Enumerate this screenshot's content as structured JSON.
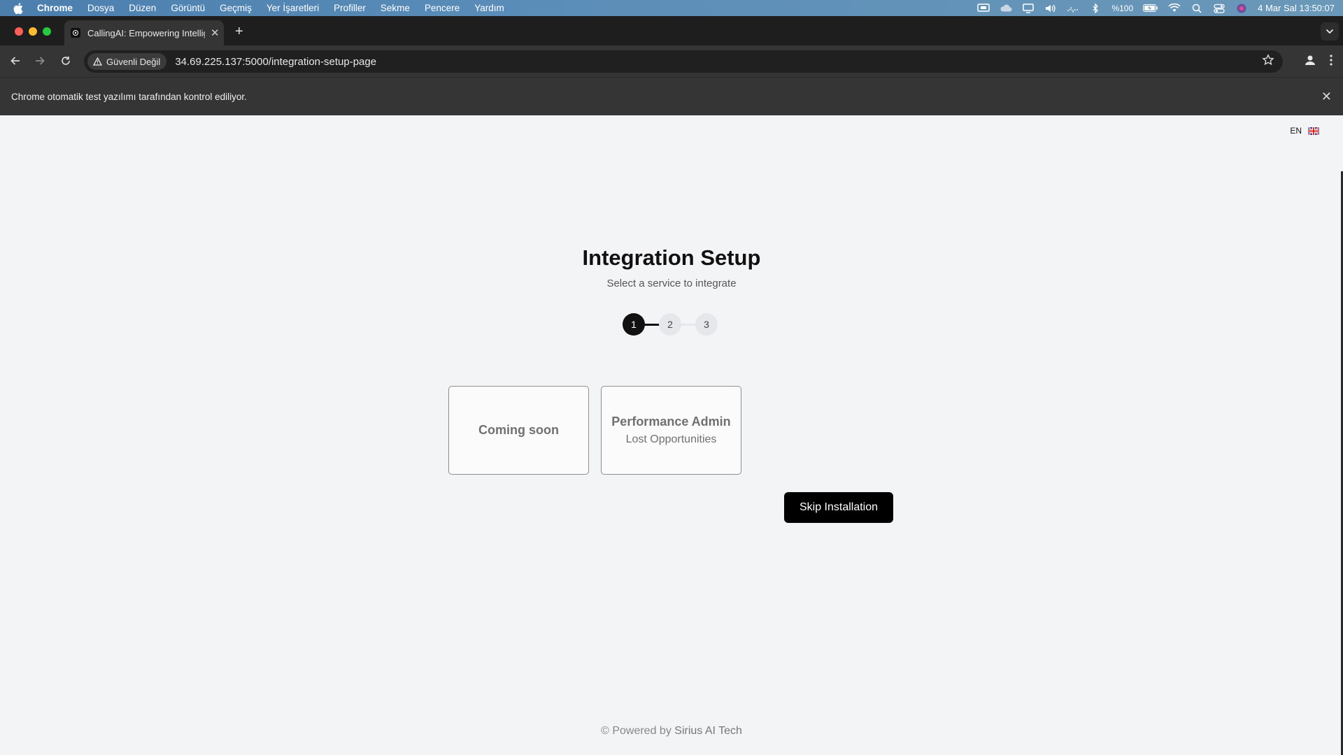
{
  "menubar": {
    "items": [
      "Chrome",
      "Dosya",
      "Düzen",
      "Görüntü",
      "Geçmiş",
      "Yer İşaretleri",
      "Profiller",
      "Sekme",
      "Pencere",
      "Yardım"
    ],
    "battery": "%100",
    "datetime": "4 Mar Sal  13:50:07"
  },
  "browser": {
    "tab_title": "CallingAI: Empowering Intelligent",
    "security_label": "Güvenli Değil",
    "url": "34.69.225.137:5000/integration-setup-page",
    "infobar_message": "Chrome otomatik test yazılımı tarafından kontrol ediliyor."
  },
  "page": {
    "language": "EN",
    "title": "Integration Setup",
    "subtitle": "Select a service to integrate",
    "steps": [
      "1",
      "2",
      "3"
    ],
    "active_step": 1,
    "cards": [
      {
        "title": "Coming soon",
        "subtitle": ""
      },
      {
        "title": "Performance Admin",
        "subtitle": "Lost Opportunities"
      }
    ],
    "skip_button": "Skip Installation",
    "footer_prefix": "© Powered by ",
    "footer_brand": "Sirius AI Tech"
  },
  "colors": {
    "page_bg": "#f3f4f6",
    "primary": "#000000",
    "step_inactive": "#e5e7eb",
    "card_border": "#8e8e8e"
  }
}
